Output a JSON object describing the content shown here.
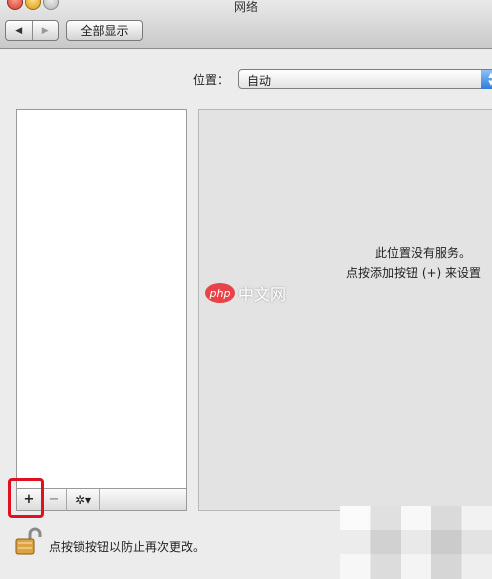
{
  "window": {
    "title": "网络"
  },
  "toolbar": {
    "back_label": "◀",
    "forward_label": "▶",
    "show_all_label": "全部显示"
  },
  "location": {
    "label": "位置：",
    "value": "自动"
  },
  "service_list": {
    "items": [],
    "toolbar": {
      "add_label": "+",
      "remove_label": "−",
      "action_label": "✲▾"
    }
  },
  "detail": {
    "empty_line1": "此位置没有服务。",
    "empty_line2": "点按添加按钮 (+) 来设置"
  },
  "watermark": {
    "logo": "php",
    "text": "中文网"
  },
  "footer": {
    "lock_text": "点按锁按钮以防止再次更改。"
  },
  "colors": {
    "highlight": "#e0111e",
    "accent": "#2e7bdc"
  }
}
